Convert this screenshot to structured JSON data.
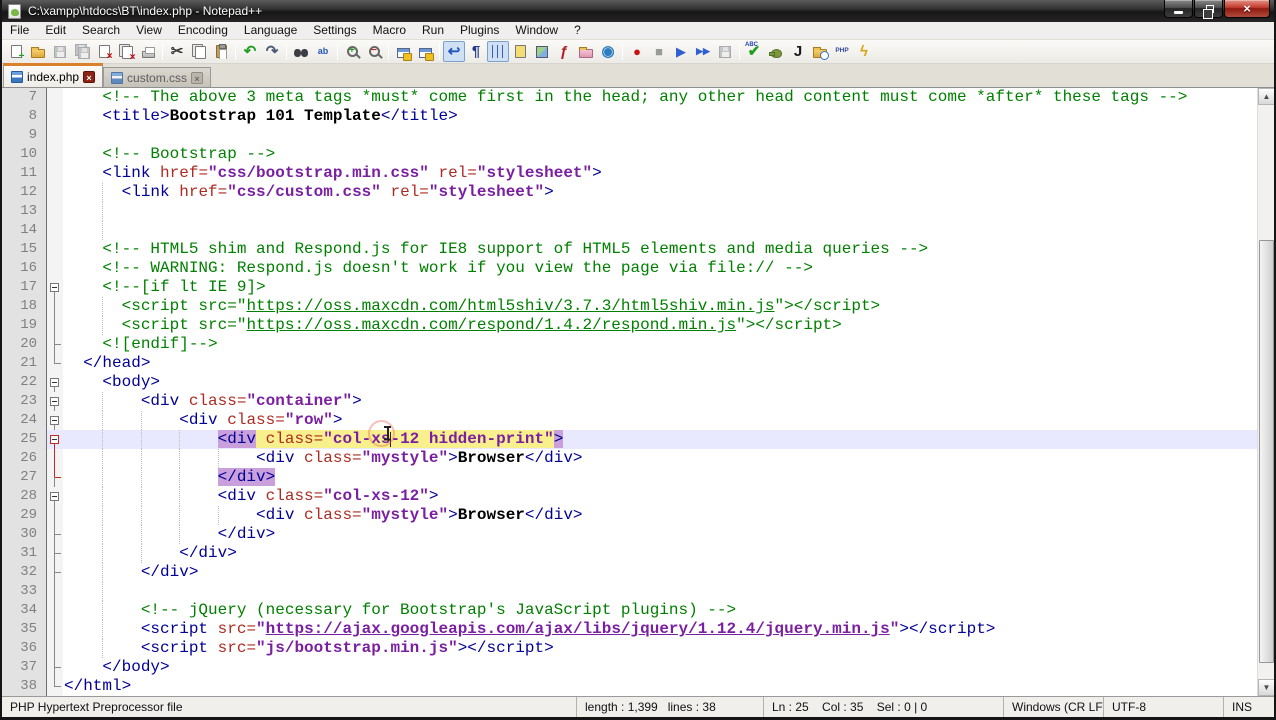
{
  "window": {
    "title": "C:\\xampp\\htdocs\\BT\\index.php - Notepad++"
  },
  "menu": {
    "items": [
      "File",
      "Edit",
      "Search",
      "View",
      "Encoding",
      "Language",
      "Settings",
      "Macro",
      "Run",
      "Plugins",
      "Window",
      "?"
    ]
  },
  "toolbar": {
    "items": [
      {
        "name": "new-file-icon",
        "k": "page",
        "mod": "new"
      },
      {
        "name": "open-file-icon",
        "k": "folder",
        "mod": ""
      },
      {
        "name": "save-icon",
        "k": "floppy",
        "disabled": true
      },
      {
        "name": "save-all-icon",
        "k": "floppy2",
        "disabled": true
      },
      {
        "name": "close-file-icon",
        "k": "page",
        "mod": "close"
      },
      {
        "name": "close-all-icon",
        "k": "page2",
        "mod": "close"
      },
      {
        "name": "print-icon",
        "k": "printer"
      },
      {
        "k": "sep"
      },
      {
        "name": "cut-icon",
        "k": "glyph",
        "g": "✂",
        "c": "#3a3a3a",
        "cls": "big"
      },
      {
        "name": "copy-icon",
        "k": "page2",
        "mod": ""
      },
      {
        "name": "paste-icon",
        "k": "paste"
      },
      {
        "k": "sep"
      },
      {
        "name": "undo-icon",
        "k": "glyph",
        "g": "↶",
        "c": "#1f9e1f",
        "cls": "big"
      },
      {
        "name": "redo-icon",
        "k": "glyph",
        "g": "↷",
        "c": "#4a5a72",
        "cls": "big"
      },
      {
        "k": "sep"
      },
      {
        "name": "find-icon",
        "k": "binoc"
      },
      {
        "name": "replace-icon",
        "k": "glyph",
        "g": "ab",
        "c": "#2255bb",
        "cls": "small"
      },
      {
        "k": "sep"
      },
      {
        "name": "zoom-in-icon",
        "k": "zoom",
        "g": "+",
        "c": "#1f9e1f"
      },
      {
        "name": "zoom-out-icon",
        "k": "zoom",
        "g": "−",
        "c": "#cc2222"
      },
      {
        "k": "sep"
      },
      {
        "name": "sync-vertical-icon",
        "k": "sync"
      },
      {
        "name": "sync-horizontal-icon",
        "k": "sync"
      },
      {
        "k": "sep"
      },
      {
        "name": "word-wrap-icon",
        "k": "glyph",
        "g": "↩",
        "c": "#2255bb",
        "cls": "big",
        "pressed": true
      },
      {
        "name": "show-all-characters-icon",
        "k": "glyph",
        "g": "¶",
        "c": "#223a8e",
        "cls": "big"
      },
      {
        "name": "indent-guide-icon",
        "k": "indent",
        "pressed": true
      },
      {
        "name": "define-language-icon",
        "k": "page",
        "mod": "yellow"
      },
      {
        "name": "document-map-icon",
        "k": "map"
      },
      {
        "name": "function-list-icon",
        "k": "glyph",
        "g": "ƒ",
        "c": "#b02020",
        "cls": "big"
      },
      {
        "name": "folder-as-workspace-icon",
        "k": "folder",
        "mod": "pink"
      },
      {
        "name": "monitoring-eye-icon",
        "k": "glyph",
        "g": "◉",
        "c": "#2e7dc0",
        "cls": "big"
      },
      {
        "k": "sep"
      },
      {
        "name": "macro-record-icon",
        "k": "glyph",
        "g": "●",
        "c": "#cc1111"
      },
      {
        "name": "macro-stop-icon",
        "k": "glyph",
        "g": "■",
        "c": "#9a9a9a"
      },
      {
        "name": "macro-play-icon",
        "k": "glyph",
        "g": "▶",
        "c": "#2f5fd0"
      },
      {
        "name": "macro-run-multiple-icon",
        "k": "glyph",
        "g": "▶▶",
        "c": "#2f5fd0",
        "cls": "small"
      },
      {
        "name": "macro-save-icon",
        "k": "floppy",
        "disabled": true
      },
      {
        "k": "sep"
      },
      {
        "name": "spell-check-icon",
        "k": "glyph",
        "g": "✔",
        "c": "#1f9e1f",
        "cls": "big",
        "sub": "ABC"
      },
      {
        "name": "teapot-plugin-icon",
        "k": "blob"
      },
      {
        "name": "json-tool-icon",
        "k": "glyph",
        "g": "J",
        "c": "#1a1a1a",
        "cls": "big"
      },
      {
        "name": "explorer-plugin-icon",
        "k": "folder",
        "mod": "clock"
      },
      {
        "name": "php-doc-icon",
        "k": "glyph",
        "g": "PHP",
        "c": "#334a9e",
        "cls": "tiny"
      },
      {
        "name": "run-script-icon",
        "k": "glyph",
        "g": "ϟ",
        "c": "#d9a514",
        "cls": "big"
      }
    ]
  },
  "tabs": [
    {
      "label": "index.php",
      "active": true
    },
    {
      "label": "custom.css",
      "active": false
    }
  ],
  "editor": {
    "first_line_number": 7,
    "caret": {
      "line": 25,
      "col": 35
    },
    "lines": [
      {
        "n": 7,
        "fold": "",
        "guides": [],
        "tokens": [
          [
            "p",
            "    "
          ],
          [
            "c",
            "<!-- The above 3 meta tags *must* come first in the head; any other head content must come *after* these tags -->"
          ]
        ]
      },
      {
        "n": 8,
        "fold": "",
        "guides": [],
        "tokens": [
          [
            "p",
            "    "
          ],
          [
            "t",
            "<title>"
          ],
          [
            "x",
            "Bootstrap 101 Template"
          ],
          [
            "t",
            "</title>"
          ]
        ]
      },
      {
        "n": 9,
        "fold": "",
        "guides": [],
        "tokens": []
      },
      {
        "n": 10,
        "fold": "",
        "guides": [],
        "tokens": [
          [
            "p",
            "    "
          ],
          [
            "c",
            "<!-- Bootstrap -->"
          ]
        ]
      },
      {
        "n": 11,
        "fold": "",
        "guides": [],
        "tokens": [
          [
            "p",
            "    "
          ],
          [
            "t",
            "<link"
          ],
          [
            "p",
            " "
          ],
          [
            "a",
            "href="
          ],
          [
            "s",
            "\"css/bootstrap.min.css\""
          ],
          [
            "p",
            " "
          ],
          [
            "a",
            "rel="
          ],
          [
            "s",
            "\"stylesheet\""
          ],
          [
            "t",
            ">"
          ]
        ]
      },
      {
        "n": 12,
        "fold": "",
        "guides": [
          4
        ],
        "tokens": [
          [
            "p",
            "      "
          ],
          [
            "t",
            "<link"
          ],
          [
            "p",
            " "
          ],
          [
            "a",
            "href="
          ],
          [
            "s",
            "\"css/custom.css\""
          ],
          [
            "p",
            " "
          ],
          [
            "a",
            "rel="
          ],
          [
            "s",
            "\"stylesheet\""
          ],
          [
            "t",
            ">"
          ]
        ]
      },
      {
        "n": 13,
        "fold": "",
        "guides": [
          4
        ],
        "tokens": []
      },
      {
        "n": 14,
        "fold": "",
        "guides": [
          4
        ],
        "tokens": []
      },
      {
        "n": 15,
        "fold": "",
        "guides": [],
        "tokens": [
          [
            "p",
            "    "
          ],
          [
            "c",
            "<!-- HTML5 shim and Respond.js for IE8 support of HTML5 elements and media queries -->"
          ]
        ]
      },
      {
        "n": 16,
        "fold": "",
        "guides": [],
        "tokens": [
          [
            "p",
            "    "
          ],
          [
            "c",
            "<!-- WARNING: Respond.js doesn't work if you view the page via file:// -->"
          ]
        ]
      },
      {
        "n": 17,
        "fold": "box",
        "guides": [],
        "tokens": [
          [
            "p",
            "    "
          ],
          [
            "c",
            "<!--[if lt IE 9]>"
          ]
        ]
      },
      {
        "n": 18,
        "fold": "v",
        "guides": [
          4
        ],
        "tokens": [
          [
            "p",
            "      "
          ],
          [
            "c",
            "<script src=\""
          ],
          [
            "cu",
            "https://oss.maxcdn.com/html5shiv/3.7.3/html5shiv.min.js"
          ],
          [
            "c",
            "\"></script>"
          ]
        ]
      },
      {
        "n": 19,
        "fold": "v",
        "guides": [
          4
        ],
        "tokens": [
          [
            "p",
            "      "
          ],
          [
            "c",
            "<script src=\""
          ],
          [
            "cu",
            "https://oss.maxcdn.com/respond/1.4.2/respond.min.js"
          ],
          [
            "c",
            "\"></script>"
          ]
        ]
      },
      {
        "n": 20,
        "fold": "tee",
        "guides": [],
        "tokens": [
          [
            "p",
            "    "
          ],
          [
            "c",
            "<![endif]-->"
          ]
        ]
      },
      {
        "n": 21,
        "fold": "end",
        "guides": [],
        "tokens": [
          [
            "p",
            "  "
          ],
          [
            "t",
            "</head>"
          ]
        ]
      },
      {
        "n": 22,
        "fold": "box",
        "guides": [],
        "tokens": [
          [
            "p",
            "    "
          ],
          [
            "t",
            "<body>"
          ]
        ]
      },
      {
        "n": 23,
        "fold": "box",
        "guides": [
          4
        ],
        "tokens": [
          [
            "p",
            "        "
          ],
          [
            "t",
            "<div"
          ],
          [
            "p",
            " "
          ],
          [
            "a",
            "class="
          ],
          [
            "s",
            "\"container\""
          ],
          [
            "t",
            ">"
          ]
        ]
      },
      {
        "n": 24,
        "fold": "box",
        "guides": [
          4,
          8
        ],
        "tokens": [
          [
            "p",
            "            "
          ],
          [
            "t",
            "<div"
          ],
          [
            "p",
            " "
          ],
          [
            "a",
            "class="
          ],
          [
            "s",
            "\"row\""
          ],
          [
            "t",
            ">"
          ]
        ]
      },
      {
        "n": 25,
        "fold": "boxR",
        "cur": true,
        "guides": [
          4,
          8,
          12
        ],
        "tokens": [
          [
            "p",
            "                "
          ],
          [
            "t hlT",
            "<div"
          ],
          [
            "p hlA",
            " "
          ],
          [
            "a hlA",
            "class="
          ],
          [
            "s hlA",
            "\"col-xs-12 hidden-print\""
          ],
          [
            "t hlT",
            ">"
          ]
        ]
      },
      {
        "n": 26,
        "fold": "vR",
        "guides": [
          4,
          8,
          12,
          16
        ],
        "tokens": [
          [
            "p",
            "                    "
          ],
          [
            "t",
            "<div"
          ],
          [
            "p",
            " "
          ],
          [
            "a",
            "class="
          ],
          [
            "s",
            "\"mystyle\""
          ],
          [
            "t",
            ">"
          ],
          [
            "x",
            "Browser"
          ],
          [
            "t",
            "</div>"
          ]
        ]
      },
      {
        "n": 27,
        "fold": "teeR",
        "guides": [
          4,
          8,
          12
        ],
        "tokens": [
          [
            "p",
            "                "
          ],
          [
            "t hlT",
            "</div>"
          ]
        ]
      },
      {
        "n": 28,
        "fold": "box",
        "guides": [
          4,
          8,
          12
        ],
        "tokens": [
          [
            "p",
            "                "
          ],
          [
            "t",
            "<div"
          ],
          [
            "p",
            " "
          ],
          [
            "a",
            "class="
          ],
          [
            "s",
            "\"col-xs-12\""
          ],
          [
            "t",
            ">"
          ]
        ]
      },
      {
        "n": 29,
        "fold": "v",
        "guides": [
          4,
          8,
          12,
          16
        ],
        "tokens": [
          [
            "p",
            "                    "
          ],
          [
            "t",
            "<div"
          ],
          [
            "p",
            " "
          ],
          [
            "a",
            "class="
          ],
          [
            "s",
            "\"mystyle\""
          ],
          [
            "t",
            ">"
          ],
          [
            "x",
            "Browser"
          ],
          [
            "t",
            "</div>"
          ]
        ]
      },
      {
        "n": 30,
        "fold": "tee",
        "guides": [
          4,
          8,
          12
        ],
        "tokens": [
          [
            "p",
            "                "
          ],
          [
            "t",
            "</div>"
          ]
        ]
      },
      {
        "n": 31,
        "fold": "tee",
        "guides": [
          4,
          8
        ],
        "tokens": [
          [
            "p",
            "            "
          ],
          [
            "t",
            "</div>"
          ]
        ]
      },
      {
        "n": 32,
        "fold": "tee",
        "guides": [
          4
        ],
        "tokens": [
          [
            "p",
            "        "
          ],
          [
            "t",
            "</div>"
          ]
        ]
      },
      {
        "n": 33,
        "fold": "v",
        "guides": [
          4
        ],
        "tokens": []
      },
      {
        "n": 34,
        "fold": "v",
        "guides": [
          4
        ],
        "tokens": [
          [
            "p",
            "        "
          ],
          [
            "c",
            "<!-- jQuery (necessary for Bootstrap's JavaScript plugins) -->"
          ]
        ]
      },
      {
        "n": 35,
        "fold": "v",
        "guides": [
          4
        ],
        "tokens": [
          [
            "p",
            "        "
          ],
          [
            "t",
            "<script"
          ],
          [
            "p",
            " "
          ],
          [
            "a",
            "src="
          ],
          [
            "s",
            "\""
          ],
          [
            "su",
            "https://ajax.googleapis.com/ajax/libs/jquery/1.12.4/jquery.min.js"
          ],
          [
            "s",
            "\""
          ],
          [
            "t",
            "></script>"
          ]
        ]
      },
      {
        "n": 36,
        "fold": "v",
        "guides": [
          4
        ],
        "tokens": [
          [
            "p",
            "        "
          ],
          [
            "t",
            "<script"
          ],
          [
            "p",
            " "
          ],
          [
            "a",
            "src="
          ],
          [
            "s",
            "\"js/bootstrap.min.js\""
          ],
          [
            "t",
            "></script>"
          ]
        ]
      },
      {
        "n": 37,
        "fold": "tee",
        "guides": [],
        "tokens": [
          [
            "p",
            "    "
          ],
          [
            "t",
            "</body>"
          ]
        ]
      },
      {
        "n": 38,
        "fold": "end",
        "guides": [],
        "tokens": [
          [
            "t",
            "</html>"
          ]
        ]
      }
    ]
  },
  "scrollbar": {
    "up_glyph": "▲",
    "down_glyph": "▼"
  },
  "status": {
    "doc_type": "PHP Hypertext Preprocessor file",
    "length_lines": "length : 1,399   lines : 38",
    "position": "Ln : 25    Col : 35    Sel : 0 | 0",
    "eol": "Windows (CR LF)",
    "encoding": "UTF-8",
    "insert_mode": "INS"
  },
  "colors": {
    "comment": "#008000",
    "tag": "#000096",
    "attribute": "#ae2b22",
    "string": "#7b1fa2",
    "current_line_bg": "#e8e8ff",
    "tag_match_bg": "#c9a0dc",
    "attr_match_bg": "#f8f08c",
    "active_tab_accent": "#d9822b",
    "fold_highlight": "#c22a1c"
  }
}
